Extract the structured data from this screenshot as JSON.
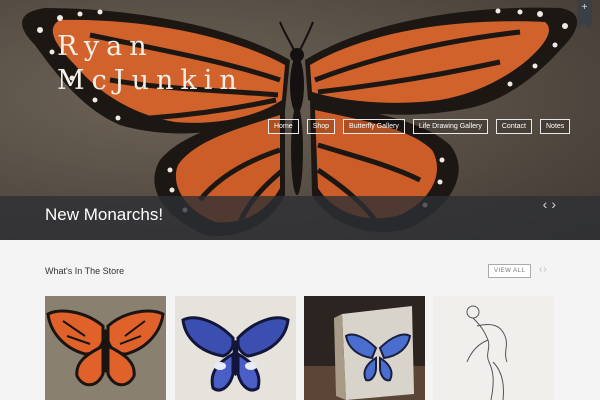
{
  "brand": {
    "line1": "Ryan",
    "line2": "McJunkin"
  },
  "nav": {
    "home": "Home",
    "shop": "Shop",
    "butterfly_gallery": "Butterfly Gallery",
    "life_drawing_gallery": "Life Drawing Gallery",
    "contact": "Contact",
    "notes": "Notes"
  },
  "corner_toggle": "+",
  "slider": {
    "caption": "New Monarchs!",
    "prev": "‹",
    "next": "›"
  },
  "store": {
    "title": "What's In The Store",
    "view_all": "VIEW ALL",
    "prev": "‹",
    "next": "›"
  },
  "colors": {
    "accent": "#e0622a",
    "bar": "#2d3034",
    "blue": "#3b4fb0"
  },
  "icons": [
    "plus-icon",
    "chevron-left-icon",
    "chevron-right-icon"
  ]
}
